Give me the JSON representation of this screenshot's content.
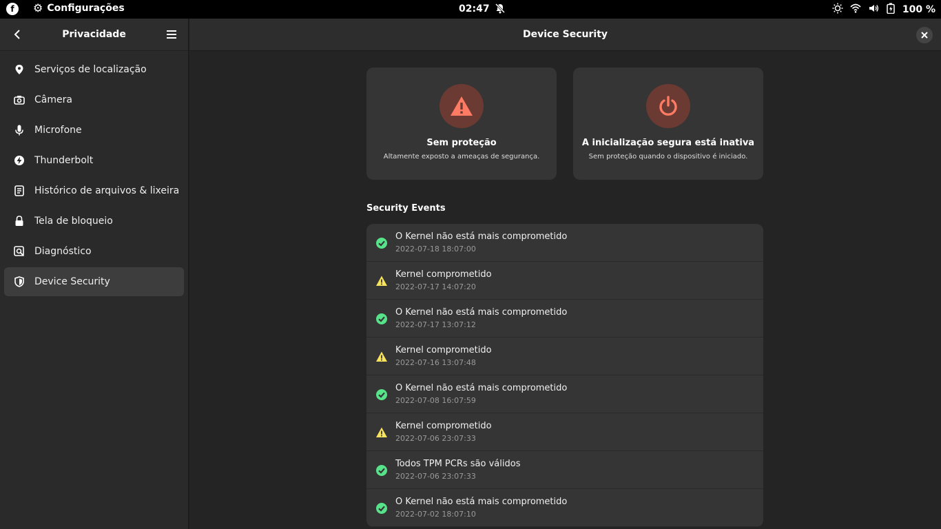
{
  "topbar": {
    "app_name": "Configurações",
    "clock": "02:47",
    "battery": "100 %"
  },
  "sidebar": {
    "title": "Privacidade",
    "items": [
      {
        "label": "Serviços de localização",
        "icon": "location-icon"
      },
      {
        "label": "Câmera",
        "icon": "camera-icon"
      },
      {
        "label": "Microfone",
        "icon": "microphone-icon"
      },
      {
        "label": "Thunderbolt",
        "icon": "thunderbolt-icon"
      },
      {
        "label": "Histórico de arquivos & lixeira",
        "icon": "file-history-icon"
      },
      {
        "label": "Tela de bloqueio",
        "icon": "lock-icon"
      },
      {
        "label": "Diagnóstico",
        "icon": "diagnostics-icon"
      },
      {
        "label": "Device Security",
        "icon": "shield-icon"
      }
    ]
  },
  "main": {
    "title": "Device Security",
    "cards": [
      {
        "title": "Sem proteção",
        "subtitle": "Altamente exposto a ameaças de segurança.",
        "icon": "warning-icon"
      },
      {
        "title": "A inicialização segura está inativa",
        "subtitle": "Sem proteção quando o dispositivo é iniciado.",
        "icon": "power-icon"
      }
    ],
    "events_title": "Security Events",
    "events": [
      {
        "title": "O Kernel não está mais comprometido",
        "date": "2022-07-18 18:07:00",
        "status": "ok"
      },
      {
        "title": "Kernel comprometido",
        "date": "2022-07-17 14:07:20",
        "status": "warn"
      },
      {
        "title": "O Kernel não está mais comprometido",
        "date": "2022-07-17 13:07:12",
        "status": "ok"
      },
      {
        "title": "Kernel comprometido",
        "date": "2022-07-16 13:07:48",
        "status": "warn"
      },
      {
        "title": "O Kernel não está mais comprometido",
        "date": "2022-07-08 16:07:59",
        "status": "ok"
      },
      {
        "title": "Kernel comprometido",
        "date": "2022-07-06 23:07:33",
        "status": "warn"
      },
      {
        "title": "Todos TPM PCRs são válidos",
        "date": "2022-07-06 23:07:33",
        "status": "ok"
      },
      {
        "title": "O Kernel não está mais comprometido",
        "date": "2022-07-02 18:07:10",
        "status": "ok"
      }
    ]
  },
  "colors": {
    "ok": "#57e389",
    "warn": "#f8e45c",
    "danger": "#ff7b63"
  }
}
